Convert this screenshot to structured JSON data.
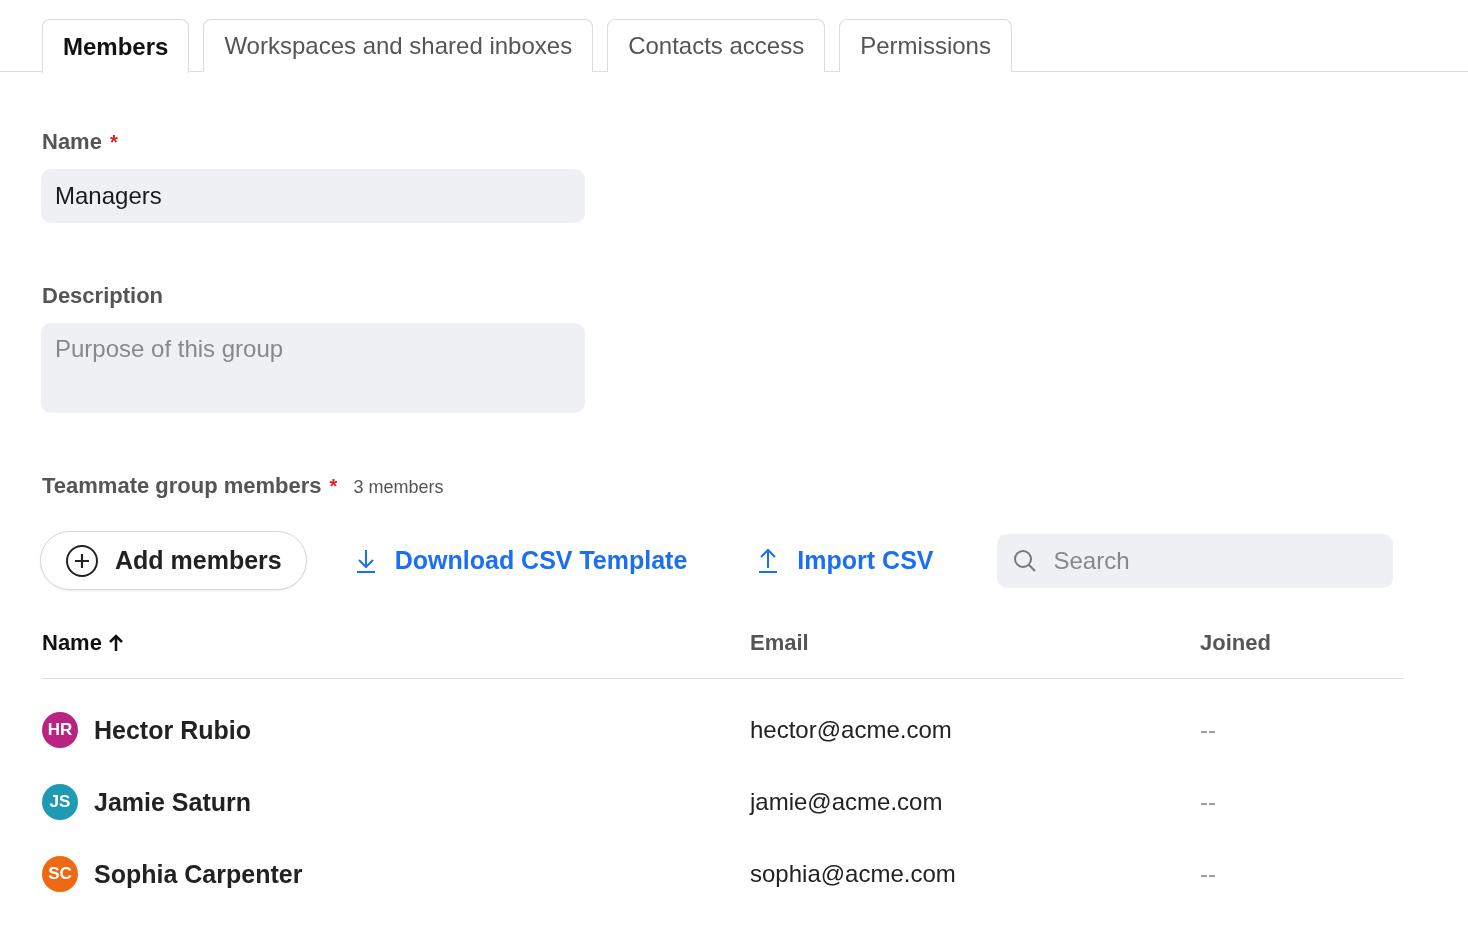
{
  "tabs": [
    {
      "label": "Members",
      "selected": true
    },
    {
      "label": "Workspaces and shared inboxes",
      "selected": false
    },
    {
      "label": "Contacts access",
      "selected": false
    },
    {
      "label": "Permissions",
      "selected": false
    }
  ],
  "name_field": {
    "label": "Name",
    "required_mark": "*",
    "value": "Managers"
  },
  "description_field": {
    "label": "Description",
    "placeholder": "Purpose of this group"
  },
  "members_section": {
    "label": "Teammate group members",
    "required_mark": "*",
    "count": "3 members"
  },
  "toolbar": {
    "add_button": "Add members",
    "download_link": "Download CSV Template",
    "import_link": "Import CSV",
    "search": {
      "placeholder": "Search"
    }
  },
  "table": {
    "columns": [
      {
        "label": "Name",
        "sorted": true
      },
      {
        "label": "Email",
        "sorted": false
      },
      {
        "label": "Joined",
        "sorted": false
      }
    ],
    "rows": [
      {
        "initials": "HR",
        "color": "#b8247f",
        "name": "Hector Rubio",
        "email": "hector@acme.com",
        "joined": "--"
      },
      {
        "initials": "JS",
        "color": "#1e9ab3",
        "name": "Jamie Saturn",
        "email": "jamie@acme.com",
        "joined": "--"
      },
      {
        "initials": "SC",
        "color": "#ee6a12",
        "name": "Sophia Carpenter",
        "email": "sophia@acme.com",
        "joined": "--"
      }
    ]
  }
}
